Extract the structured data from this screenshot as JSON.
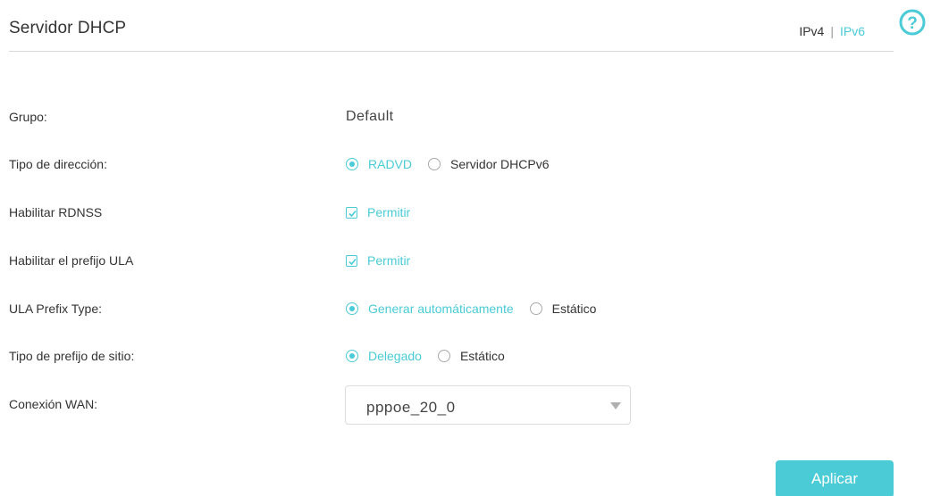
{
  "header": {
    "title": "Servidor DHCP",
    "ipv4_label": "IPv4",
    "separator": "|",
    "ipv6_label": "IPv6",
    "active_tab": "IPv6",
    "help_icon": "help-circle-icon",
    "help_glyph": "?"
  },
  "accent_color": "#4acbd6",
  "form": {
    "grupo": {
      "label": "Grupo:",
      "value": "Default"
    },
    "tipo_direccion": {
      "label": "Tipo de dirección:",
      "options": [
        "RADVD",
        "Servidor DHCPv6"
      ],
      "selected": "RADVD"
    },
    "rdnss": {
      "label": "Habilitar RDNSS",
      "checkbox_label": "Permitir",
      "checked": true
    },
    "ula_prefix": {
      "label": "Habilitar el prefijo ULA",
      "checkbox_label": "Permitir",
      "checked": true
    },
    "ula_prefix_type": {
      "label": "ULA Prefix Type:",
      "options": [
        "Generar automáticamente",
        "Estático"
      ],
      "selected": "Generar automáticamente"
    },
    "site_prefix_type": {
      "label": "Tipo de prefijo de sitio:",
      "options": [
        "Delegado",
        "Estático"
      ],
      "selected": "Delegado"
    },
    "wan": {
      "label": "Conexión WAN:",
      "selected": "pppoe_20_0"
    }
  },
  "actions": {
    "apply_label": "Aplicar"
  }
}
